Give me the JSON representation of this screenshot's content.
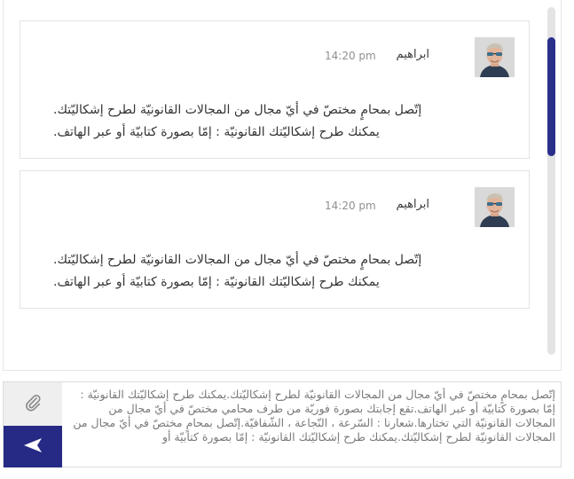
{
  "messages": [
    {
      "sender": "ابراهيم",
      "time": "14:20 pm",
      "avatar_icon": "user-avatar-photo",
      "lines": [
        ".إتّصل بمحامٍ مختصّ في أيّ مجال من المجالات القانونيّة لطرح إشكاليّتك",
        ".يمكنك طرح إشكاليّتك القانونيّة : إمّا بصورة كتابيّة أو عبر الهاتف"
      ]
    },
    {
      "sender": "ابراهيم",
      "time": "14:20 pm",
      "avatar_icon": "user-avatar-photo",
      "lines": [
        ".إتّصل بمحامٍ مختصّ في أيّ مجال من المجالات القانونيّة لطرح إشكاليّتك",
        ".يمكنك طرح إشكاليّتك القانونيّة : إمّا بصورة كتابيّة أو عبر الهاتف"
      ]
    }
  ],
  "composer": {
    "text": "إتّصل بمحامٍ مختصّ في أيّ مجال من المجالات القانونيّة لطرح إشكاليّتك.يمكنك طرح إشكاليّتك القانونيّة : إمّا بصورة كتابيّة أو عبر الهاتف.تقع إجابتك بصورة فوريّة من طرف محامي مختصّ في أيّ مجال من المجالات القانونيّة التي تختارها.شعارنا : السّرعة ، النّجاعة ، الشّفافيّة.إتّصل بمحامٍ مختصّ في أيّ مجال من المجالات القانونيّة لطرح إشكاليّتك.يمكنك طرح إشكاليّتك القانونيّة : إمّا بصورة كتابيّة أو",
    "attach_icon": "paperclip-icon",
    "send_icon": "send-arrow-icon"
  },
  "colors": {
    "accent": "#262a84",
    "scroll_thumb": "#2a2f8c",
    "attach_bg": "#efefef"
  }
}
